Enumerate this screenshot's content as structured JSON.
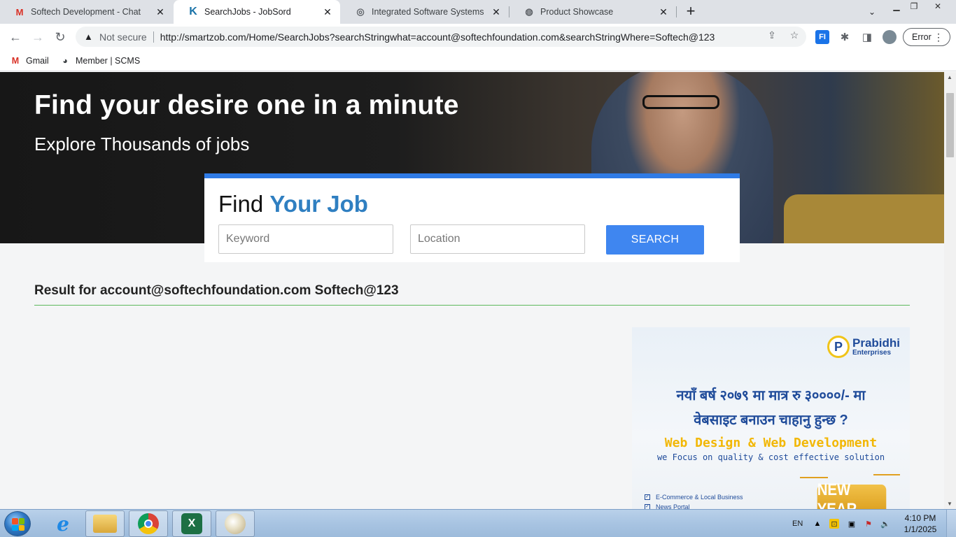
{
  "browser": {
    "tabs": [
      {
        "title": "Softech Development - Chat",
        "icon": "gmail-icon"
      },
      {
        "title": "SearchJobs - JobSord",
        "icon": "jobsord-k-icon",
        "active": true
      },
      {
        "title": "Integrated Software Systems",
        "icon": "globe-icon"
      },
      {
        "title": "Product Showcase",
        "icon": "globe-icon"
      }
    ],
    "address": {
      "security_label": "Not secure",
      "url": "http://smartzob.com/Home/SearchJobs?searchStringwhat=account@softechfoundation.com&searchStringWhere=Softech@123"
    },
    "profile_button": "Error",
    "bookmarks": [
      {
        "label": "Gmail",
        "icon": "gmail-icon"
      },
      {
        "label": "Member | SCMS",
        "icon": "globe-icon"
      }
    ]
  },
  "page": {
    "hero": {
      "title": "Find your desire one in a minute",
      "subtitle": "Explore Thousands of jobs"
    },
    "search": {
      "heading_plain": "Find",
      "heading_accent": "Your Job",
      "keyword_placeholder": "Keyword",
      "location_placeholder": "Location",
      "button_label": "SEARCH"
    },
    "result_text": "Result for account@softechfoundation.com Softech@123",
    "ad": {
      "brand_initial": "P",
      "brand_name": "Prabidhi",
      "brand_sub": "Enterprises",
      "line1": "नयाँ बर्ष २०७९ मा मात्र रु ३००००/- मा",
      "line2": "वेबसाइट बनाउन चाहानु हुन्छ ?",
      "headline": "Web Design & Web Development",
      "tagline": "we Focus on quality & cost effective solution",
      "items": [
        "E-Commerce & Local Business",
        "News Portal"
      ],
      "badge": "NEW YEAR"
    }
  },
  "taskbar": {
    "pinned": [
      "internet-explorer-icon",
      "file-explorer-icon",
      "chrome-icon",
      "excel-icon",
      "paint-icon"
    ],
    "language": "EN",
    "time": "4:10 PM",
    "date": "1/1/2025"
  },
  "colors": {
    "accent_blue": "#3f86f0",
    "heading_accent": "#2f7fc1",
    "result_rule": "#5cb85c"
  }
}
